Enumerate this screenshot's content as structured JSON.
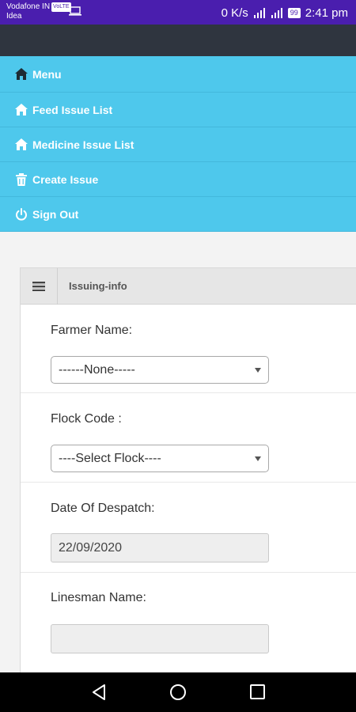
{
  "status_bar": {
    "carrier_line1": "Vodafone IN",
    "volte_badge": "VoLTE",
    "carrier_line2": "Idea",
    "net_speed": "0 K/s",
    "battery": "99",
    "time": "2:41 pm"
  },
  "nav": {
    "items": [
      {
        "label": "Menu",
        "icon": "home-icon"
      },
      {
        "label": "Feed Issue List",
        "icon": "home-icon"
      },
      {
        "label": "Medicine Issue List",
        "icon": "home-icon"
      },
      {
        "label": "Create Issue",
        "icon": "trash-icon"
      },
      {
        "label": "Sign Out",
        "icon": "power-icon"
      }
    ]
  },
  "panel": {
    "title": "Issuing-info",
    "farmer_name": {
      "label": "Farmer Name:",
      "value": "------None-----"
    },
    "flock_code": {
      "label": "Flock Code :",
      "value": "----Select Flock----"
    },
    "date_of_despatch": {
      "label": "Date Of Despatch:",
      "value": "22/09/2020"
    },
    "linesman_name": {
      "label": "Linesman Name:",
      "value": ""
    }
  },
  "colors": {
    "status_bar": "#4a1eae",
    "app_bar": "#2f353f",
    "nav_background": "#4ec8ec",
    "content_background": "#f3f3f3"
  }
}
